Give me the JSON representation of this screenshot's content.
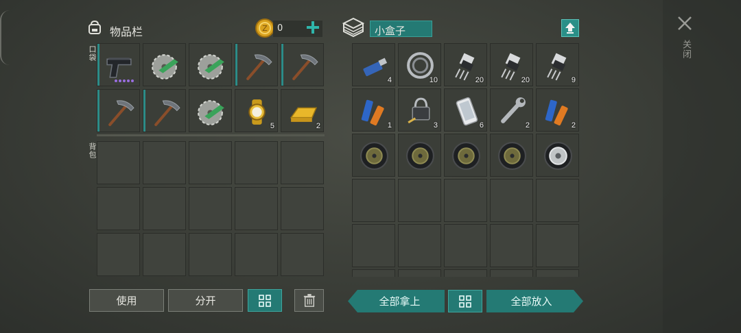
{
  "inventory": {
    "title": "物品栏",
    "coins": "0",
    "pocket_label": "口袋",
    "backpack_label": "背包",
    "pocket_slots": [
      {
        "icon": "pistol-icon",
        "qty": "",
        "bar": true,
        "dots": true
      },
      {
        "icon": "saw-blade-icon",
        "qty": "",
        "bar": false
      },
      {
        "icon": "saw-blade-icon",
        "qty": "",
        "bar": false
      },
      {
        "icon": "pickaxe-icon",
        "qty": "",
        "bar": true
      },
      {
        "icon": "pickaxe-icon",
        "qty": "",
        "bar": true
      },
      {
        "icon": "pickaxe-icon",
        "qty": "",
        "bar": true
      },
      {
        "icon": "pickaxe-icon",
        "qty": "",
        "bar": true
      },
      {
        "icon": "saw-blade-icon",
        "qty": "",
        "bar": false
      },
      {
        "icon": "gold-watch-icon",
        "qty": "5",
        "bar": false
      },
      {
        "icon": "gold-bar-icon",
        "qty": "2",
        "bar": false
      }
    ]
  },
  "container": {
    "title": "小盒子",
    "slots": [
      {
        "icon": "usb-drive-icon",
        "qty": "4"
      },
      {
        "icon": "bearing-icon",
        "qty": "10"
      },
      {
        "icon": "transistor-icon",
        "qty": "20"
      },
      {
        "icon": "transistor-icon",
        "qty": "20"
      },
      {
        "icon": "transistor-icon",
        "qty": "9"
      },
      {
        "icon": "batteries-icon",
        "qty": "1"
      },
      {
        "icon": "padlock-key-icon",
        "qty": "3"
      },
      {
        "icon": "smartphone-icon",
        "qty": "6"
      },
      {
        "icon": "wrench-icon",
        "qty": "2"
      },
      {
        "icon": "batteries-icon",
        "qty": "2"
      },
      {
        "icon": "tire-icon",
        "qty": ""
      },
      {
        "icon": "tire-icon",
        "qty": ""
      },
      {
        "icon": "tire-icon",
        "qty": ""
      },
      {
        "icon": "tire-icon",
        "qty": ""
      },
      {
        "icon": "wheel-rim-icon",
        "qty": ""
      }
    ]
  },
  "buttons": {
    "use": "使用",
    "split": "分开",
    "take_all": "全部拿上",
    "put_all": "全部放入"
  },
  "close_label": "关闭",
  "colors": {
    "accent": "#247a74",
    "gold": "#d9a21e"
  }
}
